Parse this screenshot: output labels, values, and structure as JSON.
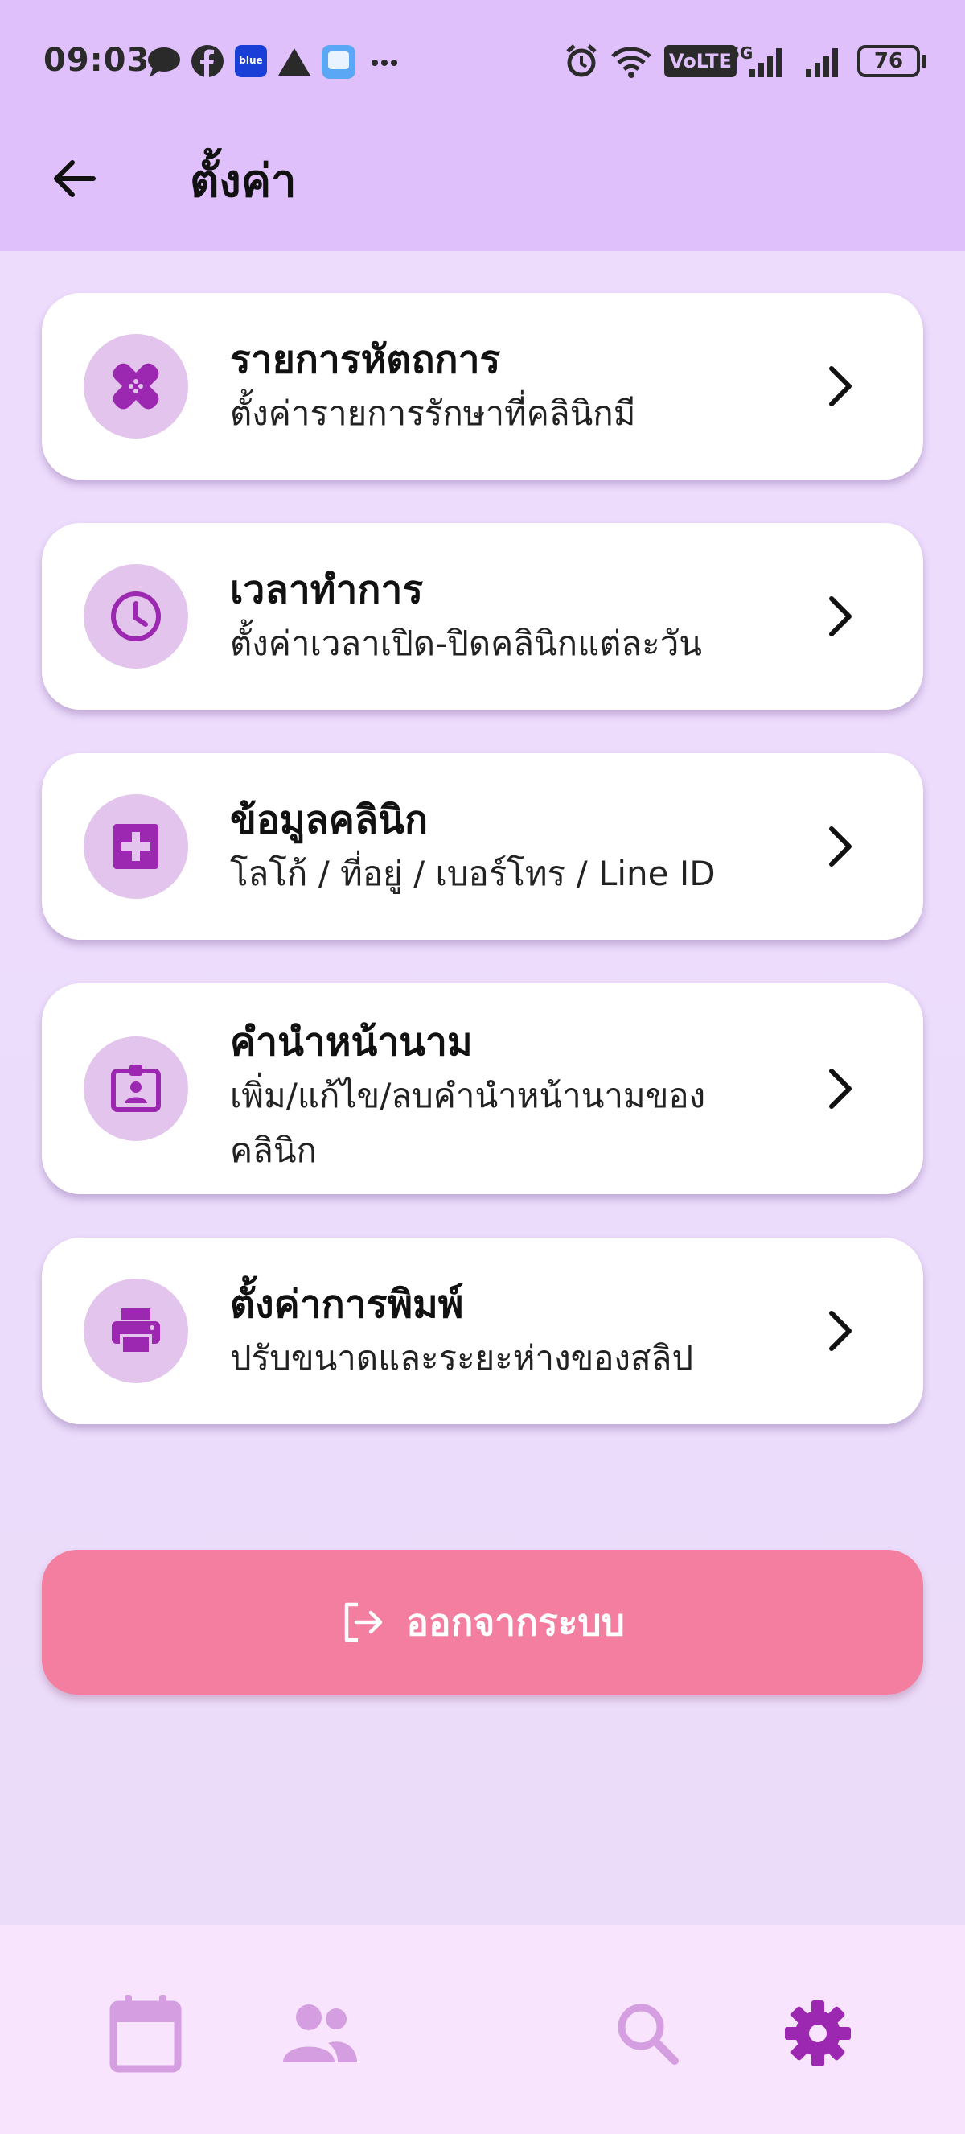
{
  "status_bar": {
    "time": "09:03",
    "volte": "VoLTE",
    "network": "5G",
    "battery": "76"
  },
  "app_bar": {
    "title": "ตั้งค่า",
    "back_icon": "arrow-left-icon"
  },
  "menu": [
    {
      "icon": "bandage-icon",
      "title": "รายการหัตถการ",
      "subtitle": "ตั้งค่ารายการรักษาที่คลินิกมี"
    },
    {
      "icon": "clock-icon",
      "title": "เวลาทำการ",
      "subtitle": "ตั้งค่าเวลาเปิด-ปิดคลินิกแต่ละวัน"
    },
    {
      "icon": "medical-cross-icon",
      "title": "ข้อมูลคลินิก",
      "subtitle": "โลโก้ / ที่อยู่ / เบอร์โทร / Line ID"
    },
    {
      "icon": "id-badge-icon",
      "title": "คำนำหน้านาม",
      "subtitle": "เพิ่ม/แก้ไข/ลบคำนำหน้านามของคลินิก"
    },
    {
      "icon": "printer-icon",
      "title": "ตั้งค่าการพิมพ์",
      "subtitle": "ปรับขนาดและระยะห่างของสลิป"
    }
  ],
  "logout": {
    "label": "ออกจากระบบ",
    "icon": "logout-icon"
  },
  "bottom_nav": [
    {
      "icon": "calendar-icon",
      "active": false
    },
    {
      "icon": "people-icon",
      "active": false
    },
    {
      "icon": "search-icon",
      "active": false
    },
    {
      "icon": "gear-icon",
      "active": true
    }
  ],
  "colors": {
    "app_bar": "#e0c0fb",
    "background": "#ede0fc",
    "icon_purple": "#9c27b0",
    "icon_circle": "#e3c4ec",
    "logout": "#f37ea0",
    "nav_inactive": "#d49ee0",
    "nav_active": "#9c27b0"
  }
}
